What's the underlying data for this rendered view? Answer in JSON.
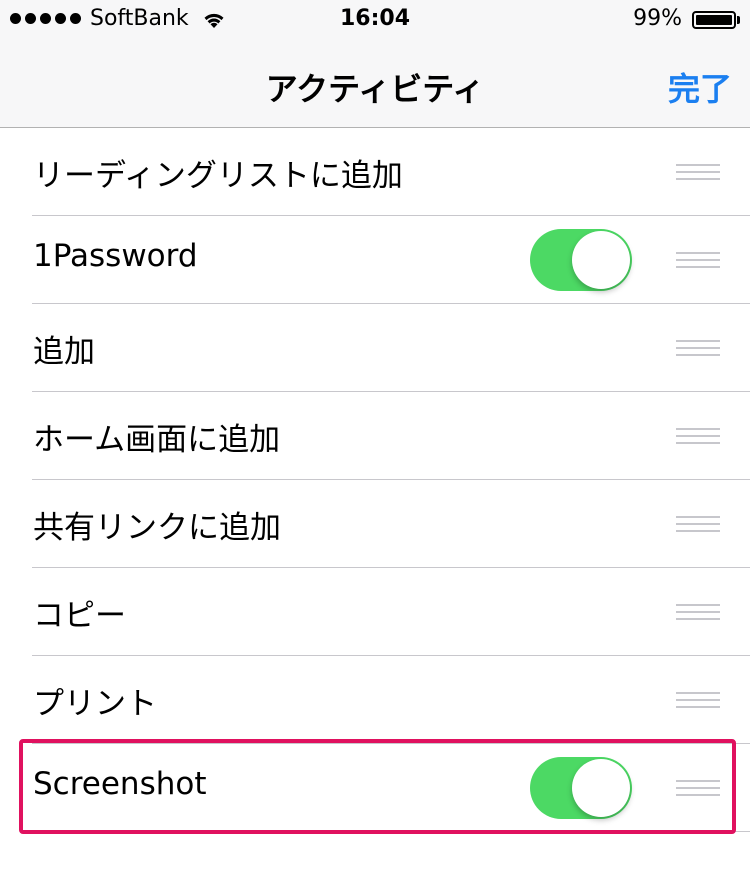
{
  "status_bar": {
    "signal_dots": 5,
    "carrier": "SoftBank",
    "wifi_icon": "wifi-icon",
    "time": "16:04",
    "battery_percent": "99%",
    "battery_level": 0.99
  },
  "nav": {
    "title": "アクティビティ",
    "done_label": "完了"
  },
  "colors": {
    "accent": "#1b7ff0",
    "toggle_on": "#4cd964",
    "highlight": "#e0115f"
  },
  "activities": [
    {
      "label": "リーディングリストに追加",
      "has_toggle": false
    },
    {
      "label": "1Password",
      "has_toggle": true,
      "toggle_on": true
    },
    {
      "label": "追加",
      "has_toggle": false
    },
    {
      "label": "ホーム画面に追加",
      "has_toggle": false
    },
    {
      "label": "共有リンクに追加",
      "has_toggle": false
    },
    {
      "label": "コピー",
      "has_toggle": false
    },
    {
      "label": "プリント",
      "has_toggle": false
    },
    {
      "label": "Screenshot",
      "has_toggle": true,
      "toggle_on": true,
      "highlighted": true
    }
  ],
  "row_icons": {
    "toggle": "toggle-switch",
    "reorder": "reorder-grip-icon"
  }
}
